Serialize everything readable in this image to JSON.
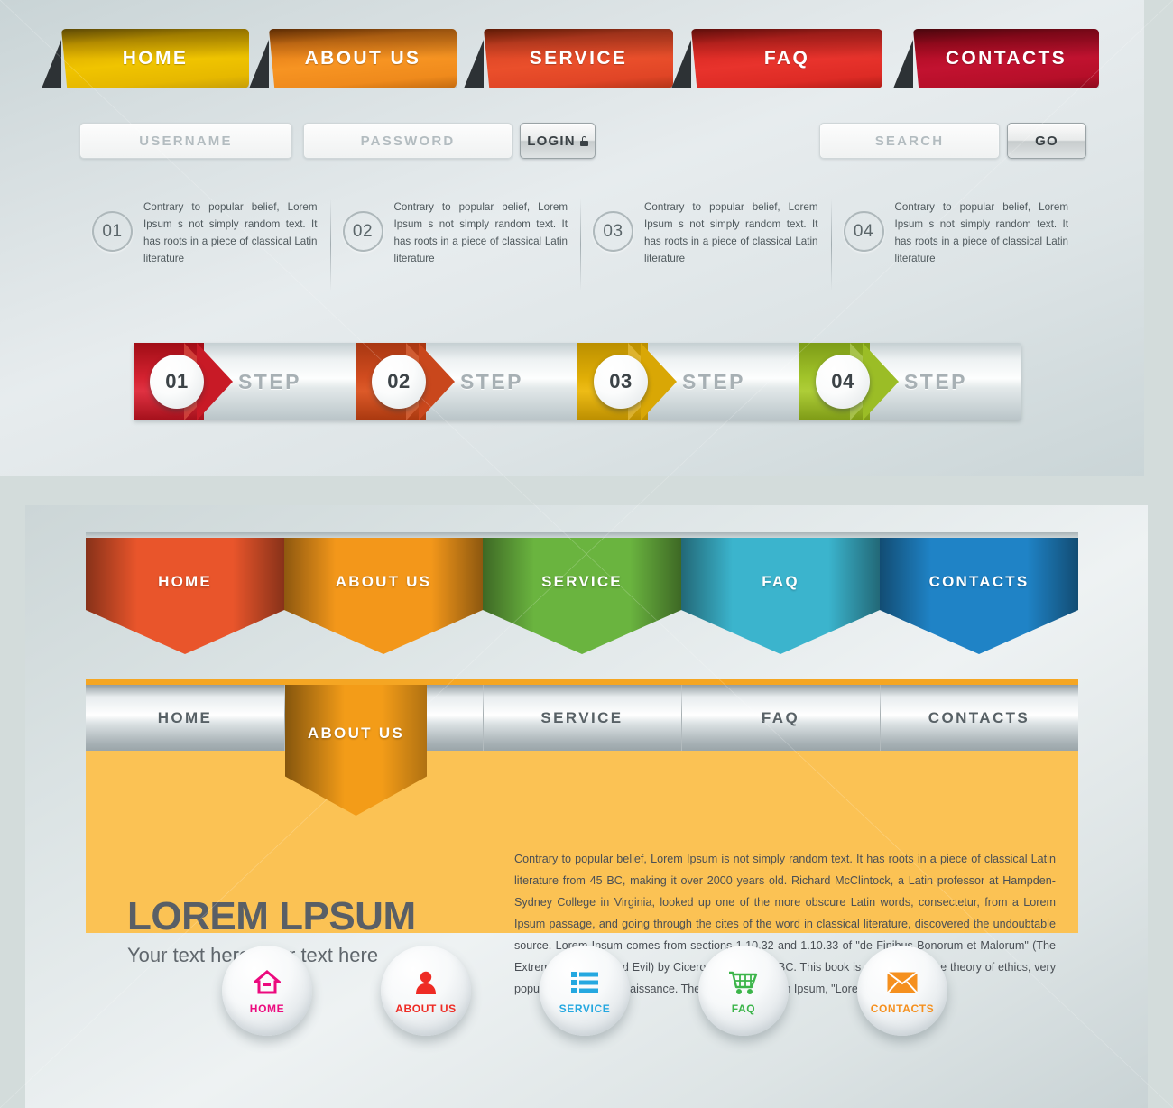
{
  "section_one": {
    "ribbon_nav": [
      {
        "label": "HOME",
        "color": "#e6b800"
      },
      {
        "label": "ABOUT US",
        "color": "#ef8a1c"
      },
      {
        "label": "SERVICE",
        "color": "#e04526"
      },
      {
        "label": "FAQ",
        "color": "#dd2b25"
      },
      {
        "label": "CONTACTS",
        "color": "#b60f29"
      }
    ],
    "login": {
      "username_placeholder": "USERNAME",
      "password_placeholder": "PASSWORD",
      "login_label": "LOGIN",
      "lock_icon": "lock-icon"
    },
    "search": {
      "placeholder": "SEARCH",
      "go_label": "GO"
    },
    "info_columns": [
      {
        "number": "01",
        "text": "Contrary to popular belief, Lorem Ipsum s not simply random text. It has roots in a piece of classical Latin literature"
      },
      {
        "number": "02",
        "text": "Contrary to popular belief, Lorem Ipsum s not simply random text. It has roots in a piece of classical Latin literature"
      },
      {
        "number": "03",
        "text": "Contrary to popular belief, Lorem Ipsum s not simply random text. It has roots in a piece of classical Latin literature"
      },
      {
        "number": "04",
        "text": "Contrary to popular belief, Lorem Ipsum s not simply random text. It has roots in a piece of classical Latin literature"
      }
    ],
    "steps": [
      {
        "number": "01",
        "label": "STEP",
        "color": "#c81a26"
      },
      {
        "number": "02",
        "label": "STEP",
        "color": "#c9471c"
      },
      {
        "number": "03",
        "label": "STEP",
        "color": "#d9a705"
      },
      {
        "number": "04",
        "label": "STEP",
        "color": "#9bbd26"
      }
    ]
  },
  "section_two": {
    "bookmark_nav": [
      {
        "label": "HOME",
        "color": "#e9552b"
      },
      {
        "label": "ABOUT US",
        "color": "#f3971a"
      },
      {
        "label": "SERVICE",
        "color": "#6ab43f"
      },
      {
        "label": "FAQ",
        "color": "#3bb4cd"
      },
      {
        "label": "CONTACTS",
        "color": "#1f83c6"
      }
    ],
    "metal_menu": [
      {
        "label": "HOME"
      },
      {
        "label": "ABOUT US"
      },
      {
        "label": "SERVICE"
      },
      {
        "label": "FAQ"
      },
      {
        "label": "CONTACTS"
      }
    ],
    "active_tab_label": "ABOUT US",
    "panel": {
      "accent_color": "#f5a623",
      "background_color": "#fbc254",
      "title": "LOREM LPSUM",
      "subtitle": "Your text here Your text here",
      "body": "Contrary to popular belief, Lorem Ipsum is not simply random text. It has roots in a piece of classical Latin literature from 45 BC, making it over 2000 years old. Richard McClintock, a Latin professor at Hampden-Sydney College in Virginia, looked up one of the more obscure Latin words, consectetur, from a Lorem Ipsum passage, and going through the cites of the word in classical literature, discovered the undoubtable source. Lorem Ipsum comes from sections 1.10.32 and 1.10.33 of \"de Finibus Bonorum et Malorum\" (The Extremes of Good and Evil) by Cicero, written in 45 BC. This book is a treatise on the theory of ethics, very popular during the Renaissance. The first line of Lorem Ipsum, \"Lorem ipsum dolor"
    },
    "circle_buttons": [
      {
        "label": "HOME",
        "icon": "home-icon",
        "color": "#ec0a7e"
      },
      {
        "label": "ABOUT US",
        "icon": "user-icon",
        "color": "#ee2b24"
      },
      {
        "label": "SERVICE",
        "icon": "list-icon",
        "color": "#25a8e0"
      },
      {
        "label": "FAQ",
        "icon": "shopping-cart-icon",
        "color": "#3cb54a"
      },
      {
        "label": "CONTACTS",
        "icon": "envelope-icon",
        "color": "#f5901e"
      }
    ]
  }
}
